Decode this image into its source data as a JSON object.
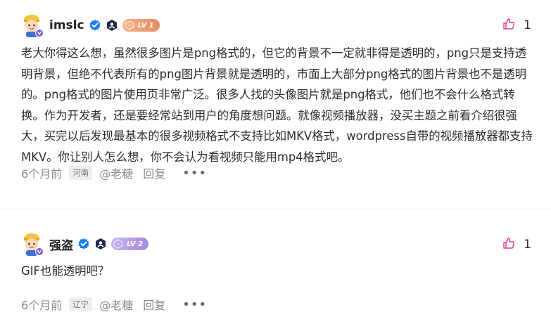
{
  "comments": [
    {
      "username": "imslc",
      "level": "LV 1",
      "likes": "1",
      "content": "老大你得这么想，虽然很多图片是png格式的，但它的背景不一定就非得是透明的，png只是支持透明背景，但绝不代表所有的png图片背景就是透明的，市面上大部分png格式的图片背景也不是透明的。png格式的图片使用页非常广泛。很多人找的头像图片就是png格式，他们也不会什么格式转换。作为开发者，还是要经常站到用户的角度想问题。就像视频播放器，没买主题之前看介绍很强大，买完以后发现最基本的很多视频格式不支持比如MKV格式，wordpress自带的视频播放器都支持MKV。你让别人怎么想，你不会认为看视频只能用mp4格式吧。",
      "time": "6个月前",
      "region": "河南",
      "mention": "@老糖",
      "reply": "回复",
      "more": "•••"
    },
    {
      "username": "强盗",
      "level": "LV 2",
      "likes": "1",
      "content": "GIF也能透明吧？",
      "time": "6个月前",
      "region": "辽宁",
      "mention": "@老糖",
      "reply": "回复",
      "more": "•••"
    }
  ],
  "colors": {
    "like_icon": "#e0359a",
    "verified": "#1e7ff0",
    "role_badge": "#1f2a44",
    "level1": "#e98a5e",
    "level2": "#a489de",
    "meta_text": "#8a8a8a"
  },
  "icons": {
    "avatar": "cartoon-avatar-yellow-hat",
    "verified": "verified-check-icon",
    "role": "hexagon-person-badge-icon",
    "like": "thumbs-up-icon",
    "more": "more-dots-icon"
  }
}
